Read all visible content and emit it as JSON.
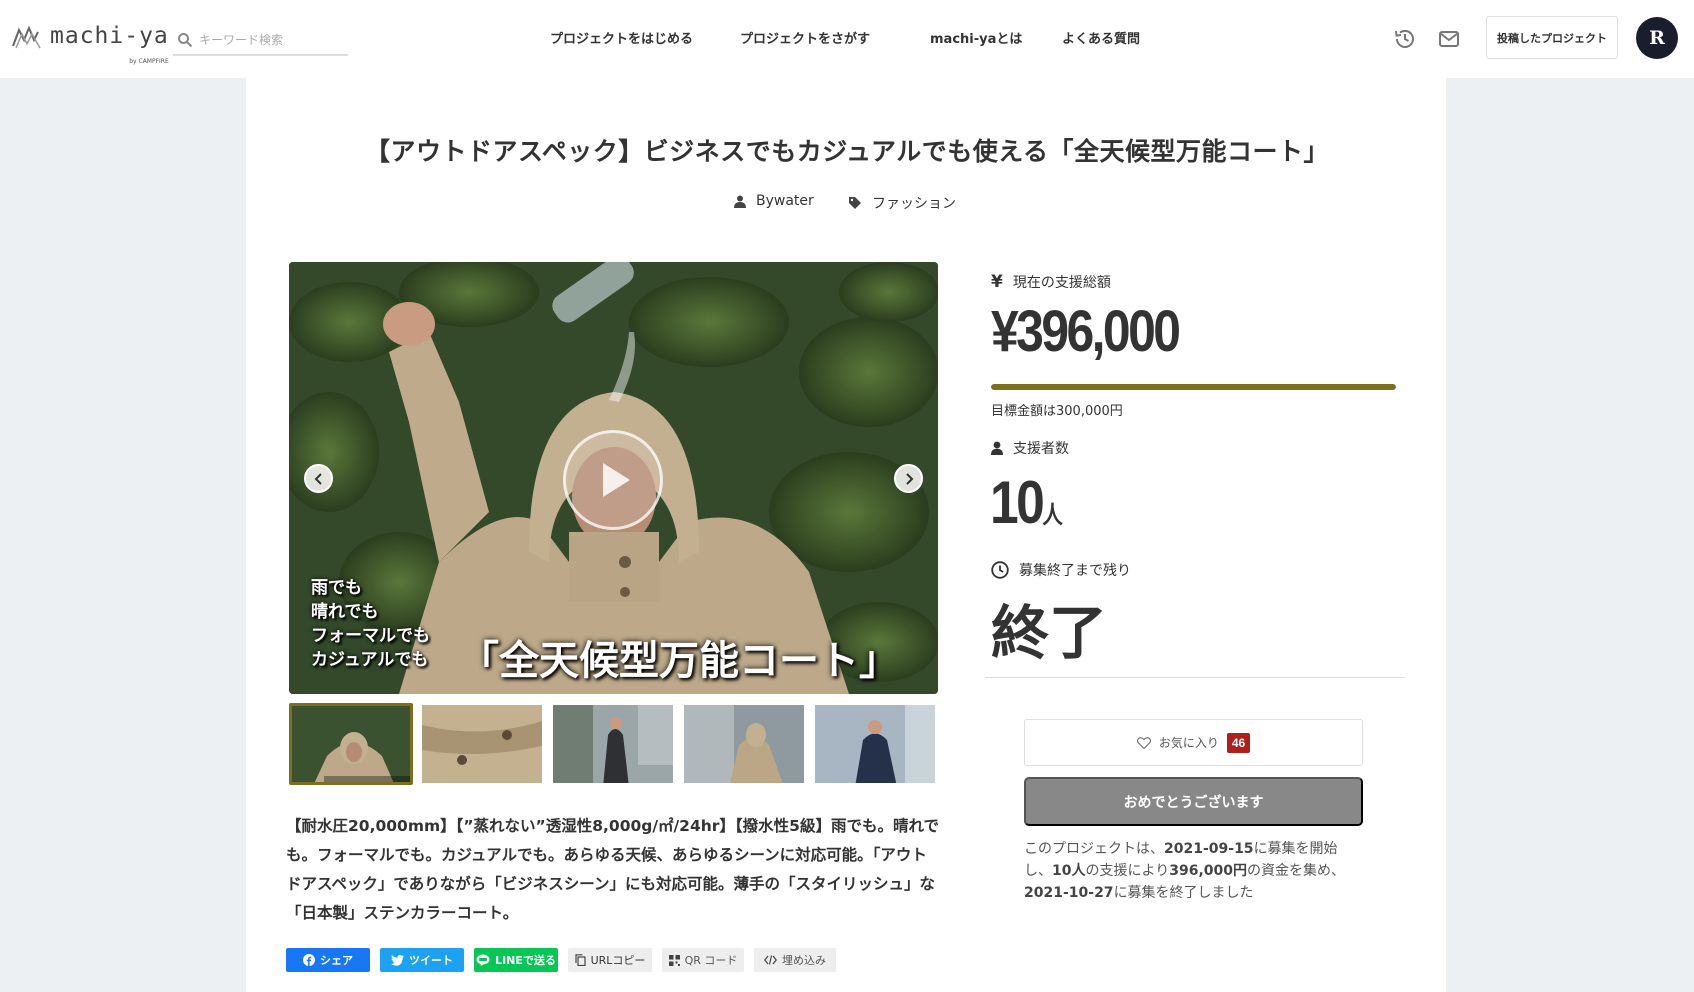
{
  "header": {
    "logo_text": "machi-ya",
    "logo_sub": "by CAMPFIRE",
    "search_placeholder": "キーワード検索",
    "nav": [
      "プロジェクトをはじめる",
      "プロジェクトをさがす",
      "machi-yaとは",
      "よくある質問"
    ],
    "posted_button": "投稿したプロジェクト",
    "avatar_letter": "R"
  },
  "project": {
    "title": "【アウトドアスペック】ビジネスでもカジュアルでも使える「全天候型万能コート」",
    "owner": "Bywater",
    "category": "ファッション",
    "hero_caption": [
      "雨でも",
      "晴れでも",
      "フォーマルでも",
      "カジュアルでも"
    ],
    "hero_headline": "「全天候型万能コート」",
    "thumbnail_count": 5,
    "description": "【耐水圧20,000mm】【”蒸れない”透湿性8,000g/㎡/24hr】【撥水性5級】雨でも。晴れでも。フォーマルでも。カジュアルでも。あらゆる天候、あらゆるシーンに対応可能。「アウトドアスペック」でありながら「ビジネスシーン」にも対応可能。薄手の「スタイリッシュ」な「日本製」ステンカラーコート。"
  },
  "share": {
    "facebook": "シェア",
    "twitter": "ツイート",
    "line": "LINEで送る",
    "url_copy": "URLコピー",
    "qr": "QR コード",
    "embed": "埋め込み"
  },
  "stats": {
    "amount_label": "現在の支援総額",
    "amount": "¥396,000",
    "progress_percent": 100,
    "goal_text": "目標金額は300,000円",
    "backers_label": "支援者数",
    "backers": "10",
    "backers_unit": "人",
    "remaining_label": "募集終了まで残り",
    "remaining": "終了"
  },
  "actions": {
    "favorite_label": "お気に入り",
    "favorite_count": "46",
    "congrats_label": "おめでとうございます"
  },
  "summary": {
    "prefix": "このプロジェクトは、",
    "start_date": "2021-09-15",
    "mid1": "に募集を開始し、",
    "backers": "10人",
    "mid2": "の支援により",
    "amount": "396,000円",
    "mid3": "の資金を集め、",
    "end_date": "2021-10-27",
    "suffix": "に募集を終了しました"
  },
  "colors": {
    "accent": "#7d6f20",
    "fav_badge": "#b01e1e",
    "congrats_button": "#888888",
    "facebook": "#1877f2",
    "twitter": "#1da1f2",
    "line": "#06c755"
  }
}
